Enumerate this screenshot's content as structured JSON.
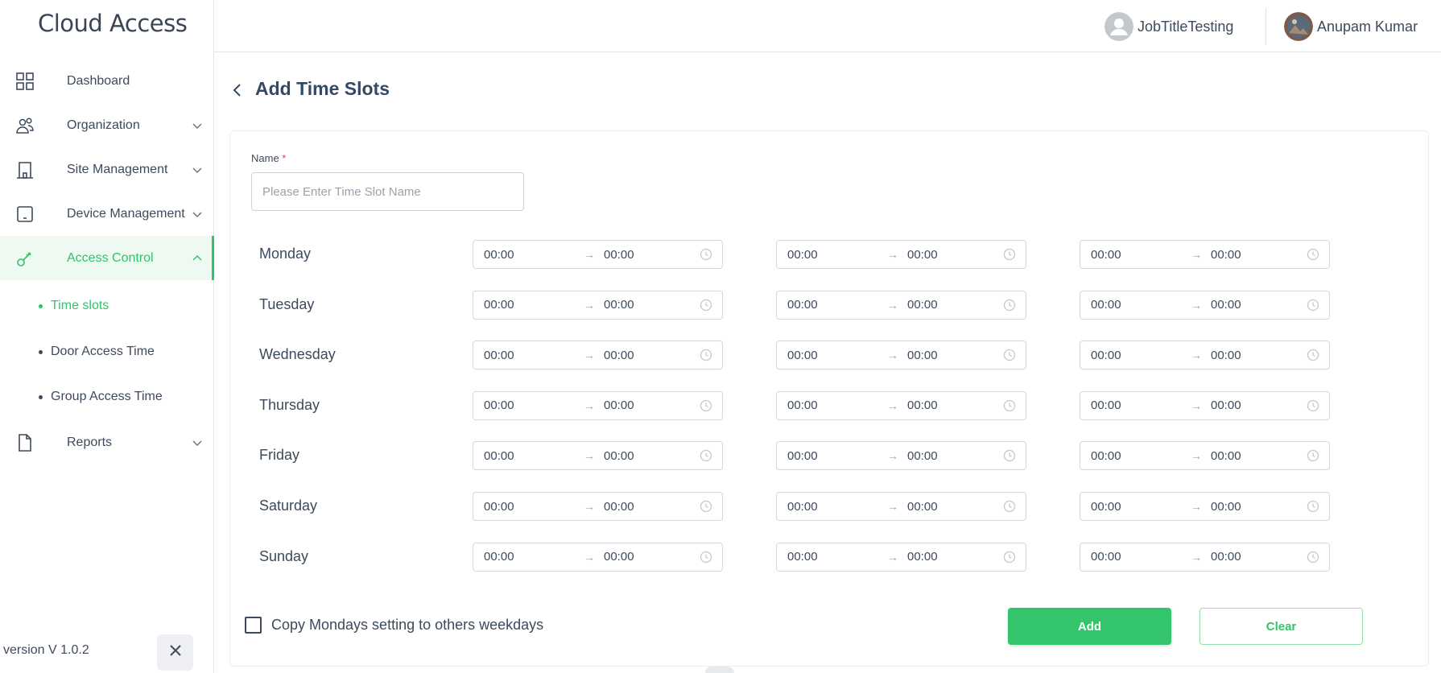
{
  "brand": "Cloud Access",
  "header": {
    "org_user": "JobTitleTesting",
    "user_name": "Anupam Kumar"
  },
  "sidebar": {
    "items": [
      {
        "label": "Dashboard",
        "icon": "grid-icon"
      },
      {
        "label": "Organization",
        "icon": "people-icon",
        "expandable": true
      },
      {
        "label": "Site Management",
        "icon": "building-icon",
        "expandable": true
      },
      {
        "label": "Device Management",
        "icon": "device-icon",
        "expandable": true
      },
      {
        "label": "Access Control",
        "icon": "key-icon",
        "expandable": true,
        "active": true
      },
      {
        "label": "Reports",
        "icon": "document-icon",
        "expandable": true
      }
    ],
    "sub_items": [
      {
        "label": "Time slots",
        "active": true
      },
      {
        "label": "Door Access Time"
      },
      {
        "label": "Group Access Time"
      }
    ],
    "version": "version V 1.0.2"
  },
  "page": {
    "title": "Add Time Slots",
    "name_label": "Name",
    "required_mark": "*",
    "name_placeholder": "Please Enter Time Slot Name",
    "name_value": ""
  },
  "schedule": {
    "days": [
      {
        "day": "Monday",
        "slots": [
          {
            "start": "00:00",
            "end": "00:00"
          },
          {
            "start": "00:00",
            "end": "00:00"
          },
          {
            "start": "00:00",
            "end": "00:00"
          }
        ]
      },
      {
        "day": "Tuesday",
        "slots": [
          {
            "start": "00:00",
            "end": "00:00"
          },
          {
            "start": "00:00",
            "end": "00:00"
          },
          {
            "start": "00:00",
            "end": "00:00"
          }
        ]
      },
      {
        "day": "Wednesday",
        "slots": [
          {
            "start": "00:00",
            "end": "00:00"
          },
          {
            "start": "00:00",
            "end": "00:00"
          },
          {
            "start": "00:00",
            "end": "00:00"
          }
        ]
      },
      {
        "day": "Thursday",
        "slots": [
          {
            "start": "00:00",
            "end": "00:00"
          },
          {
            "start": "00:00",
            "end": "00:00"
          },
          {
            "start": "00:00",
            "end": "00:00"
          }
        ]
      },
      {
        "day": "Friday",
        "slots": [
          {
            "start": "00:00",
            "end": "00:00"
          },
          {
            "start": "00:00",
            "end": "00:00"
          },
          {
            "start": "00:00",
            "end": "00:00"
          }
        ]
      },
      {
        "day": "Saturday",
        "slots": [
          {
            "start": "00:00",
            "end": "00:00"
          },
          {
            "start": "00:00",
            "end": "00:00"
          },
          {
            "start": "00:00",
            "end": "00:00"
          }
        ]
      },
      {
        "day": "Sunday",
        "slots": [
          {
            "start": "00:00",
            "end": "00:00"
          },
          {
            "start": "00:00",
            "end": "00:00"
          },
          {
            "start": "00:00",
            "end": "00:00"
          }
        ]
      }
    ]
  },
  "footer": {
    "copy_label": "Copy Mondays setting to others weekdays",
    "copy_checked": false,
    "add_label": "Add",
    "clear_label": "Clear"
  },
  "colors": {
    "accent": "#33c46c",
    "text": "#3d4a5c",
    "title": "#334a66"
  }
}
